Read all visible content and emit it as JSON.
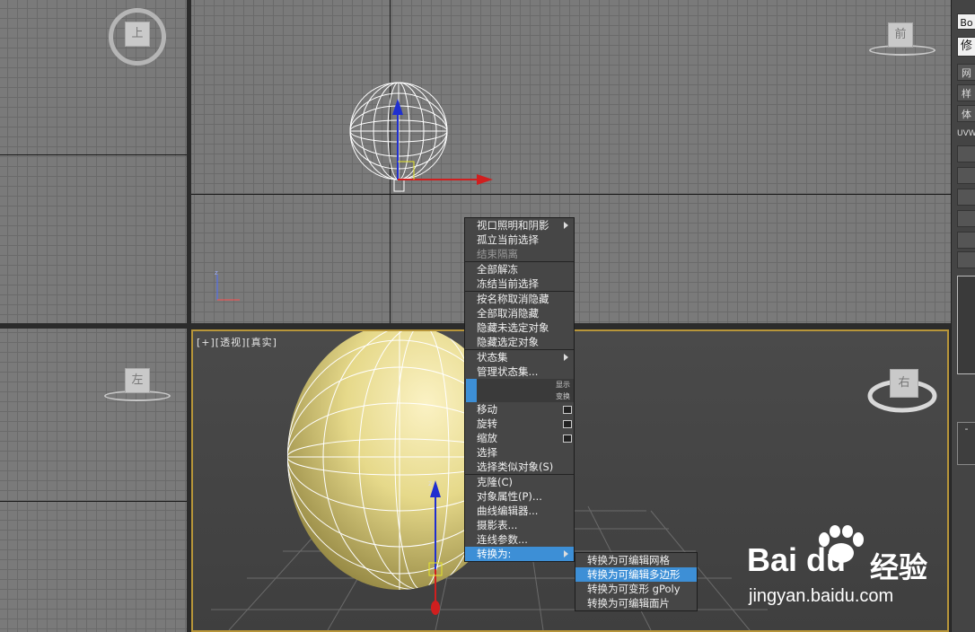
{
  "viewports": {
    "top": {
      "cube_label": "上"
    },
    "front": {
      "cube_label": "前"
    },
    "left": {
      "cube_label": "左"
    },
    "perspective": {
      "label": "[+][透视][真实]",
      "cube_label": "右"
    }
  },
  "command_panel": {
    "name_field": "Bo",
    "tab1": "修",
    "btn1": "网",
    "btn2": "样",
    "btn3": "体",
    "uvw": "UVW",
    "collapse": "-"
  },
  "context_menu": {
    "items": [
      {
        "label": "视口照明和阴影",
        "submenu": true
      },
      {
        "label": "孤立当前选择"
      },
      {
        "label": "结束隔离",
        "disabled": true
      },
      {
        "sep": true
      },
      {
        "label": "全部解冻"
      },
      {
        "label": "冻结当前选择"
      },
      {
        "sep": true
      },
      {
        "label": "按名称取消隐藏"
      },
      {
        "label": "全部取消隐藏"
      },
      {
        "label": "隐藏未选定对象"
      },
      {
        "label": "隐藏选定对象"
      },
      {
        "sep": true
      },
      {
        "label": "状态集",
        "submenu": true
      },
      {
        "label": "管理状态集..."
      },
      {
        "header": "显示"
      },
      {
        "header": "变换"
      },
      {
        "label": "移动",
        "box": true
      },
      {
        "label": "旋转",
        "box": true
      },
      {
        "label": "缩放",
        "box": true
      },
      {
        "label": "选择"
      },
      {
        "label": "选择类似对象(S)"
      },
      {
        "sep": true
      },
      {
        "label": "克隆(C)"
      },
      {
        "label": "对象属性(P)..."
      },
      {
        "label": "曲线编辑器..."
      },
      {
        "label": "摄影表..."
      },
      {
        "label": "连线参数..."
      },
      {
        "label": "转换为:",
        "submenu": true,
        "selected": true
      }
    ],
    "convert_submenu": [
      {
        "label": "转换为可编辑网格"
      },
      {
        "label": "转换为可编辑多边形",
        "selected": true
      },
      {
        "label": "转换为可变形 gPoly"
      },
      {
        "label": "转换为可编辑面片"
      }
    ]
  },
  "watermark": {
    "brand": "Bai du",
    "suffix": "经验",
    "url": "jingyan.baidu.com"
  },
  "colors": {
    "accent": "#3d8fd6",
    "active_viewport_border": "#b8963a",
    "sphere": "#e6d98a"
  }
}
